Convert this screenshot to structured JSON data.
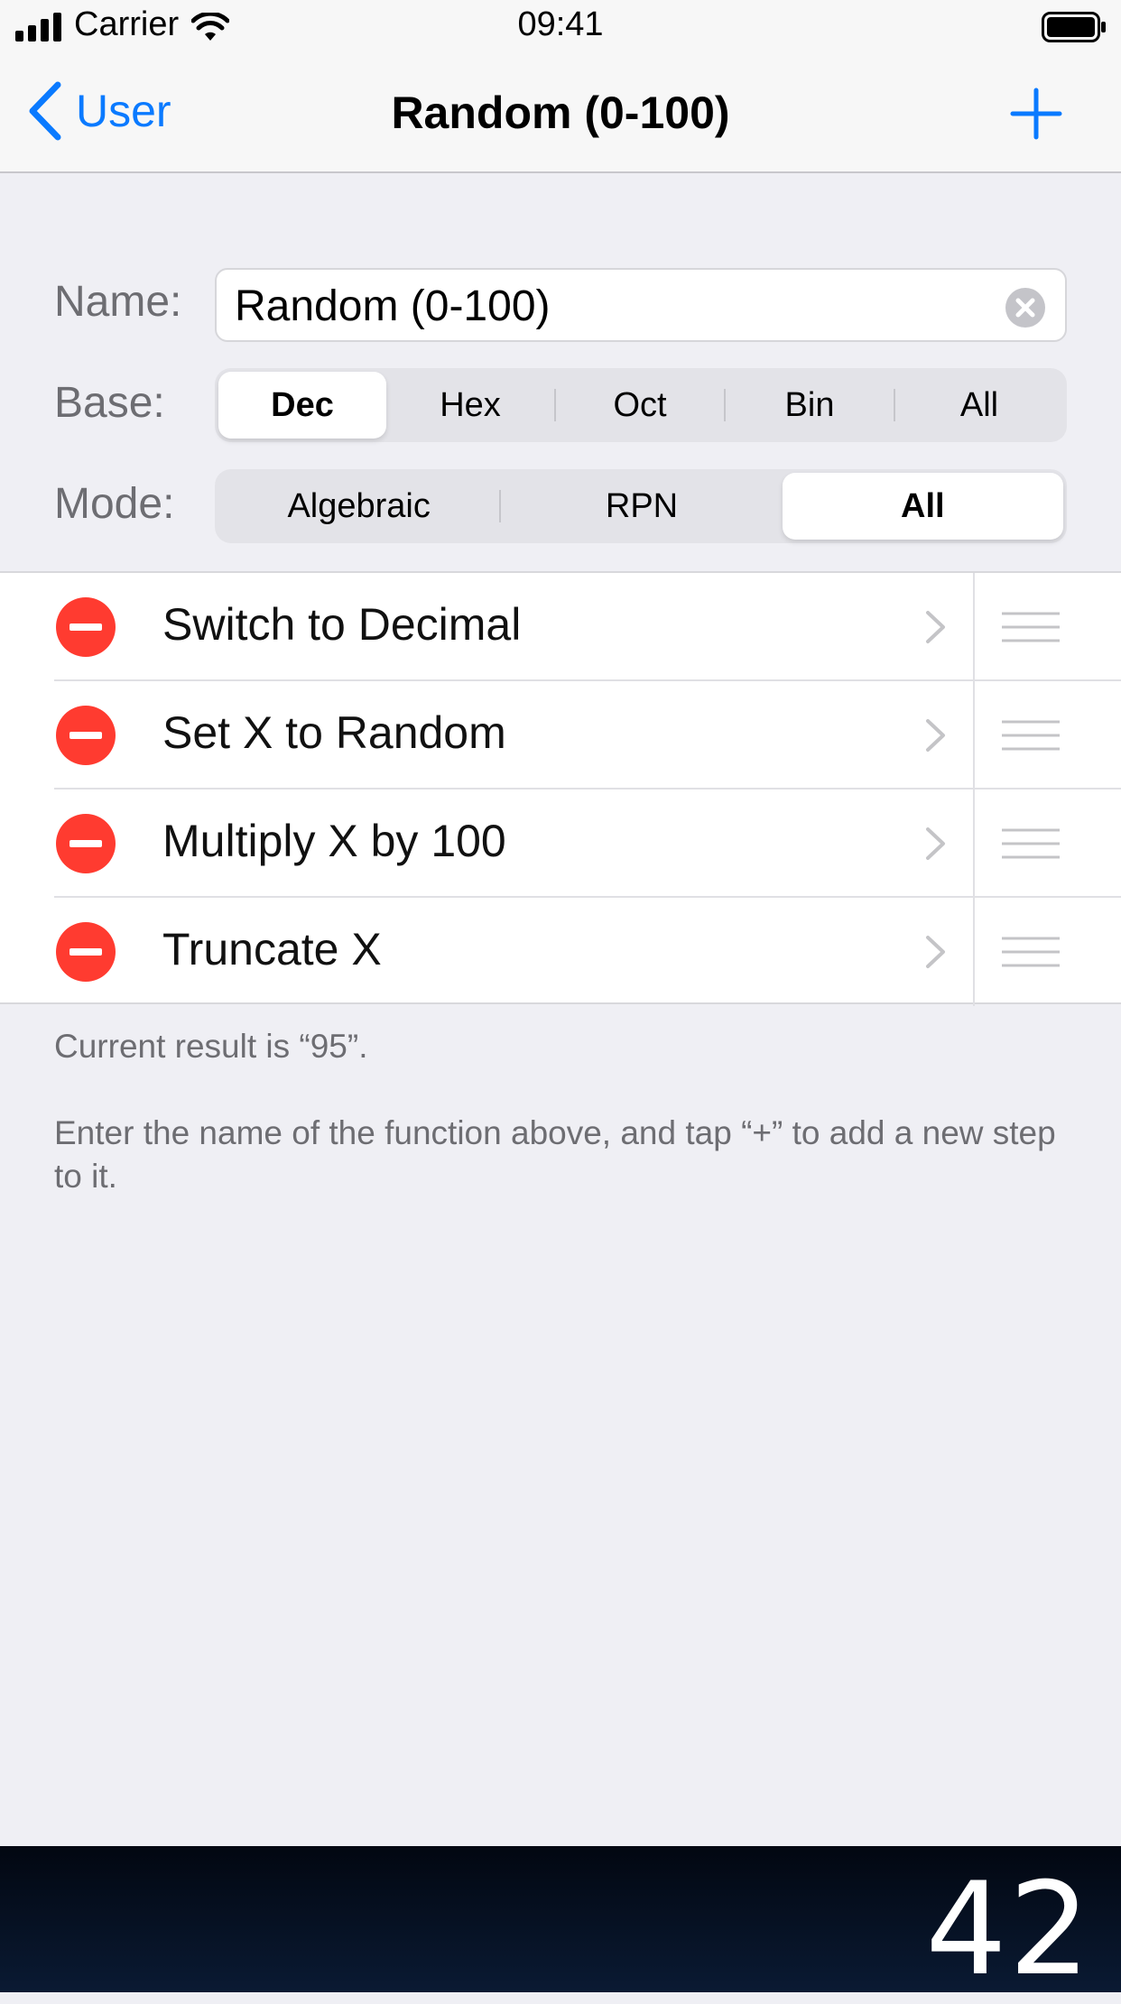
{
  "status_bar": {
    "carrier": "Carrier",
    "time": "09:41"
  },
  "nav": {
    "back_label": "User",
    "title": "Random (0-100)"
  },
  "form": {
    "name_label": "Name:",
    "name_value": "Random (0-100)",
    "base_label": "Base:",
    "base_options": [
      "Dec",
      "Hex",
      "Oct",
      "Bin",
      "All"
    ],
    "base_selected": "Dec",
    "mode_label": "Mode:",
    "mode_options": [
      "Algebraic",
      "RPN",
      "All"
    ],
    "mode_selected": "All"
  },
  "steps": [
    {
      "label": "Switch to Decimal"
    },
    {
      "label": "Set X to Random"
    },
    {
      "label": "Multiply X by 100"
    },
    {
      "label": "Truncate X"
    }
  ],
  "footer": {
    "result": "Current result is “95”.",
    "hint": "Enter the name of the function above, and tap “+” to add a new step to it."
  },
  "display": {
    "value": "42"
  },
  "colors": {
    "accent": "#0a7aff",
    "delete": "#ff3b30",
    "background": "#efeff4"
  }
}
